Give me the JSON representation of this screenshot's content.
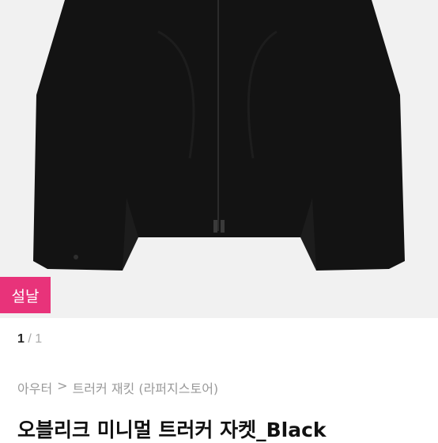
{
  "product": {
    "badge_label": "설날",
    "image_icon": "black-trucker-jacket-photo",
    "pager": {
      "current": "1",
      "separator": "/",
      "total": "1"
    },
    "breadcrumb": {
      "category": "아우터",
      "separator": ">",
      "subcategory": "트러커 재킷 (라퍼지스토어)"
    },
    "title": "오블리크 미니멀 트러커 자켓_Black"
  },
  "colors": {
    "badge": "#e8337a",
    "jacket": "#121212",
    "background": "#f1f1f1"
  }
}
